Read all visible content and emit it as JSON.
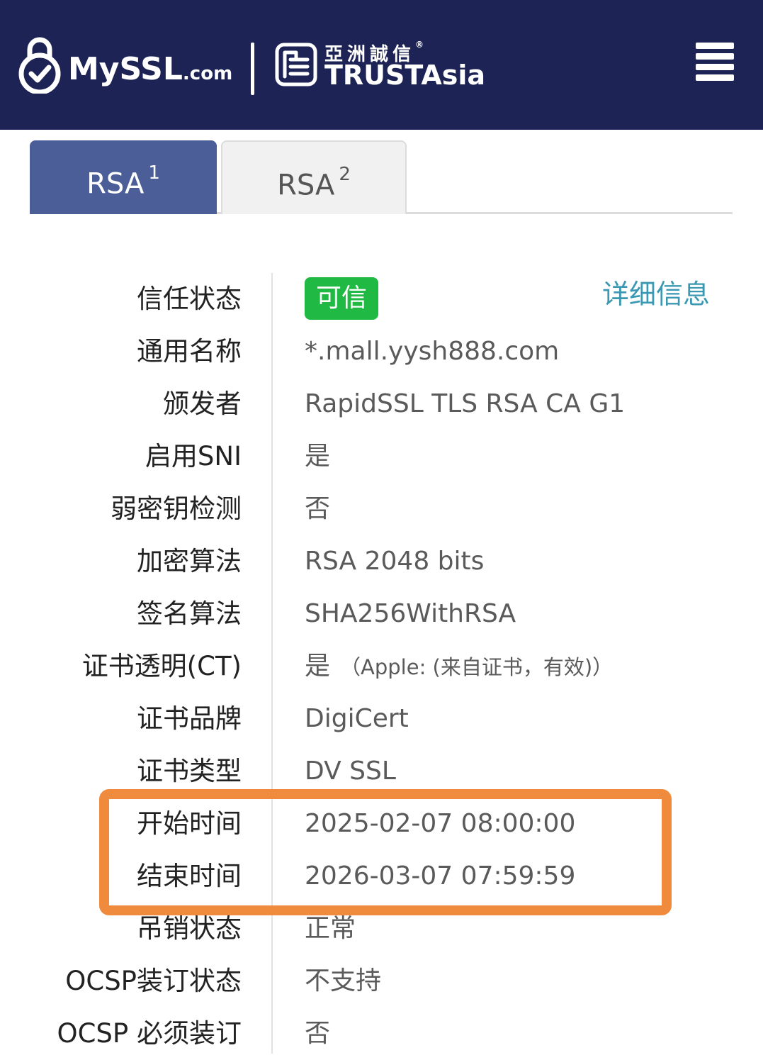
{
  "header": {
    "brand_my": "My",
    "brand_ssl": "SSL",
    "brand_dotcom": ".com",
    "partner_cn": "亞洲誠信",
    "partner_reg": "®",
    "partner_en": "TRUSTAsia",
    "background_color": "#1d2354",
    "icons": {
      "lock": "lock-check-icon",
      "partner": "trustasia-logo-icon",
      "menu": "hamburger-menu-icon"
    }
  },
  "tabs": [
    {
      "label": "RSA",
      "index": "1",
      "active": true
    },
    {
      "label": "RSA",
      "index": "2",
      "active": false
    }
  ],
  "detail_link": "详细信息",
  "rows": [
    {
      "label": "信任状态",
      "value": "可信",
      "badge": true
    },
    {
      "label": "通用名称",
      "value": "*.mall.yysh888.com"
    },
    {
      "label": "颁发者",
      "value": "RapidSSL TLS RSA CA G1"
    },
    {
      "label": "启用SNI",
      "value": "是"
    },
    {
      "label": "弱密钥检测",
      "value": "否"
    },
    {
      "label": "加密算法",
      "value": "RSA 2048 bits"
    },
    {
      "label": "签名算法",
      "value": "SHA256WithRSA"
    },
    {
      "label": "证书透明(CT)",
      "value": "是",
      "note": "（Apple: (来自证书，有效)）"
    },
    {
      "label": "证书品牌",
      "value": "DigiCert"
    },
    {
      "label": "证书类型",
      "value": "DV SSL"
    },
    {
      "label": "开始时间",
      "value": "2025-02-07 08:00:00"
    },
    {
      "label": "结束时间",
      "value": "2026-03-07 07:59:59"
    },
    {
      "label": "吊销状态",
      "value": "正常"
    },
    {
      "label": "OCSP装订状态",
      "value": "不支持"
    },
    {
      "label": "OCSP 必须装订",
      "value": "否"
    }
  ],
  "colors": {
    "badge_green": "#1fb943",
    "link_teal": "#3a98b3",
    "highlight_orange": "#f08a3c",
    "tab_active": "#4b5e98"
  }
}
